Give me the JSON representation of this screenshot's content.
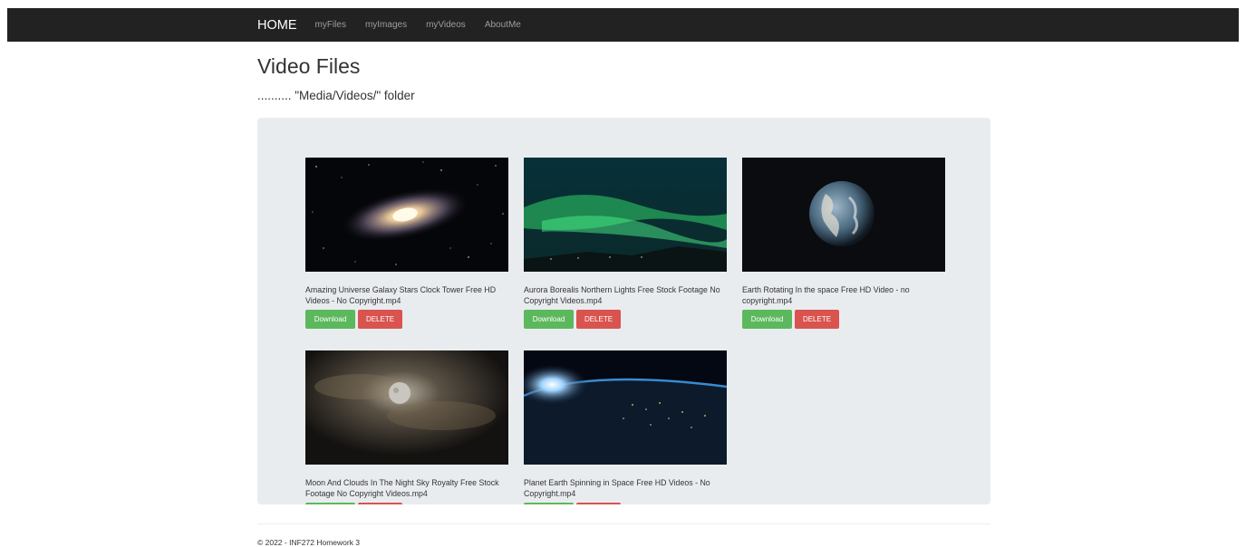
{
  "nav": {
    "brand": "HOME",
    "links": [
      "myFiles",
      "myImages",
      "myVideos",
      "AboutMe"
    ]
  },
  "page": {
    "title": "Video Files",
    "subtitle": ".......... \"Media/Videos/\" folder"
  },
  "videos": [
    {
      "caption": "Amazing Universe Galaxy Stars Clock Tower Free HD Videos - No Copyright.mp4",
      "thumb": "galaxy"
    },
    {
      "caption": "Aurora Borealis Northern Lights Free Stock Footage No Copyright Videos.mp4",
      "thumb": "aurora"
    },
    {
      "caption": "Earth Rotating In the space Free HD Video - no copyright.mp4",
      "thumb": "earth"
    },
    {
      "caption": "Moon And Clouds In The Night Sky Royalty Free Stock Footage No Copyright Videos.mp4",
      "thumb": "moon"
    },
    {
      "caption": "Planet Earth Spinning in Space Free HD Videos - No Copyright.mp4",
      "thumb": "planet"
    }
  ],
  "buttons": {
    "download": "Download",
    "delete": "DELETE"
  },
  "footer": {
    "text": "© 2022 - INF272 Homework 3"
  },
  "colors": {
    "navbar": "#222222",
    "panel": "#e9ecef",
    "download": "#5cb85c",
    "delete": "#d9534f"
  }
}
